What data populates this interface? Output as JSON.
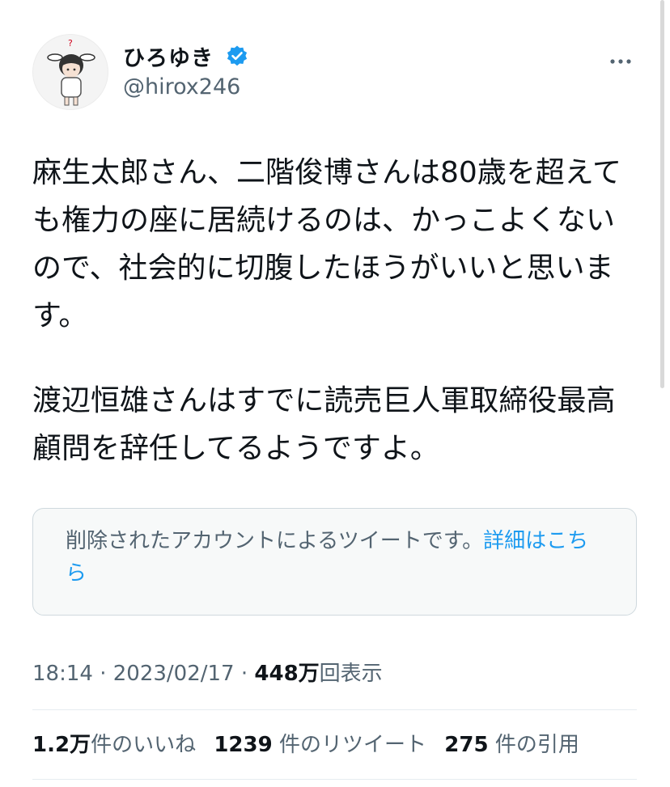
{
  "author": {
    "display_name": "ひろゆき",
    "handle": "@hirox246",
    "verified": true,
    "badge_color": "#1d9bf0"
  },
  "more_icon": "more-horizontal-icon",
  "tweet": {
    "paragraphs": [
      "麻生太郎さん、二階俊博さんは80歳を超えても権力の座に居続けるのは、かっこよくないので、社会的に切腹したほうがいいと思います。",
      "渡辺恒雄さんはすでに読売巨人軍取締役最高顧問を辞任してるようですよ。"
    ]
  },
  "quoted_notice": {
    "text": "削除されたアカウントによるツイートです。",
    "link": "詳細はこちら"
  },
  "meta": {
    "time": "18:14",
    "separator": " · ",
    "date": "2023/02/17",
    "views_value": "448万",
    "views_label": "回表示"
  },
  "stats": {
    "likes_value": "1.2万",
    "likes_label": "件のいいね",
    "retweets_value": "1239",
    "retweets_label": "件のリツイート",
    "quotes_value": "275",
    "quotes_label": "件の引用"
  }
}
